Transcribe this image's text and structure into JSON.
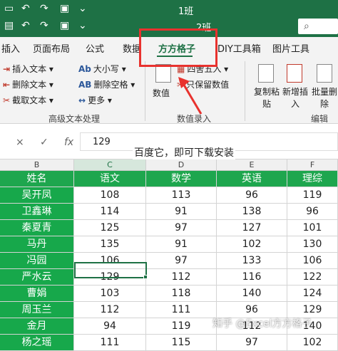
{
  "titlebar": {
    "title_top": "1班",
    "title_bottom": "2班",
    "search_icon": "search-icon"
  },
  "tabs": [
    {
      "label": "插入"
    },
    {
      "label": "页面布局"
    },
    {
      "label": "公式"
    },
    {
      "label": "数据"
    },
    {
      "label": "方方格子",
      "active": true
    },
    {
      "label": "DIY工具箱"
    },
    {
      "label": "图片工具"
    }
  ],
  "ribbon": {
    "text_group": {
      "insert_text": "插入文本",
      "delete_text": "删除文本",
      "extract_text": "截取文本",
      "case": "大小写",
      "delete_space": "删除空格",
      "more": "更多",
      "label": "高级文本处理"
    },
    "number_group": {
      "value": "数值",
      "round": "四舍五入",
      "keep_value": "只保留数值",
      "label": "数值录入"
    },
    "edit_group": {
      "copy_paste": "复制粘贴",
      "new_insert": "新增插入",
      "batch_delete": "批量删除",
      "label": "编辑"
    }
  },
  "formula_bar": {
    "value": "129",
    "fx": "fx",
    "cancel": "×",
    "confirm": "✓"
  },
  "caption": "百度它，即可下载安装",
  "sheet": {
    "col_letters": [
      "B",
      "C",
      "D",
      "E",
      "F"
    ],
    "headers": [
      "姓名",
      "语文",
      "数学",
      "英语",
      "理综"
    ],
    "rows": [
      [
        "吴开凤",
        "108",
        "113",
        "96",
        "119"
      ],
      [
        "卫鑫琳",
        "114",
        "91",
        "138",
        "96"
      ],
      [
        "秦夏青",
        "125",
        "97",
        "127",
        "101"
      ],
      [
        "马丹",
        "135",
        "91",
        "102",
        "130"
      ],
      [
        "冯园",
        "106",
        "97",
        "133",
        "106"
      ],
      [
        "严水云",
        "129",
        "112",
        "116",
        "122"
      ],
      [
        "曹娟",
        "103",
        "118",
        "140",
        "124"
      ],
      [
        "周玉兰",
        "112",
        "111",
        "96",
        "129"
      ],
      [
        "金月",
        "94",
        "119",
        "112",
        "140"
      ],
      [
        "杨之瑶",
        "111",
        "115",
        "97",
        "102"
      ]
    ]
  },
  "watermark": "知乎 @Excel方方格子"
}
